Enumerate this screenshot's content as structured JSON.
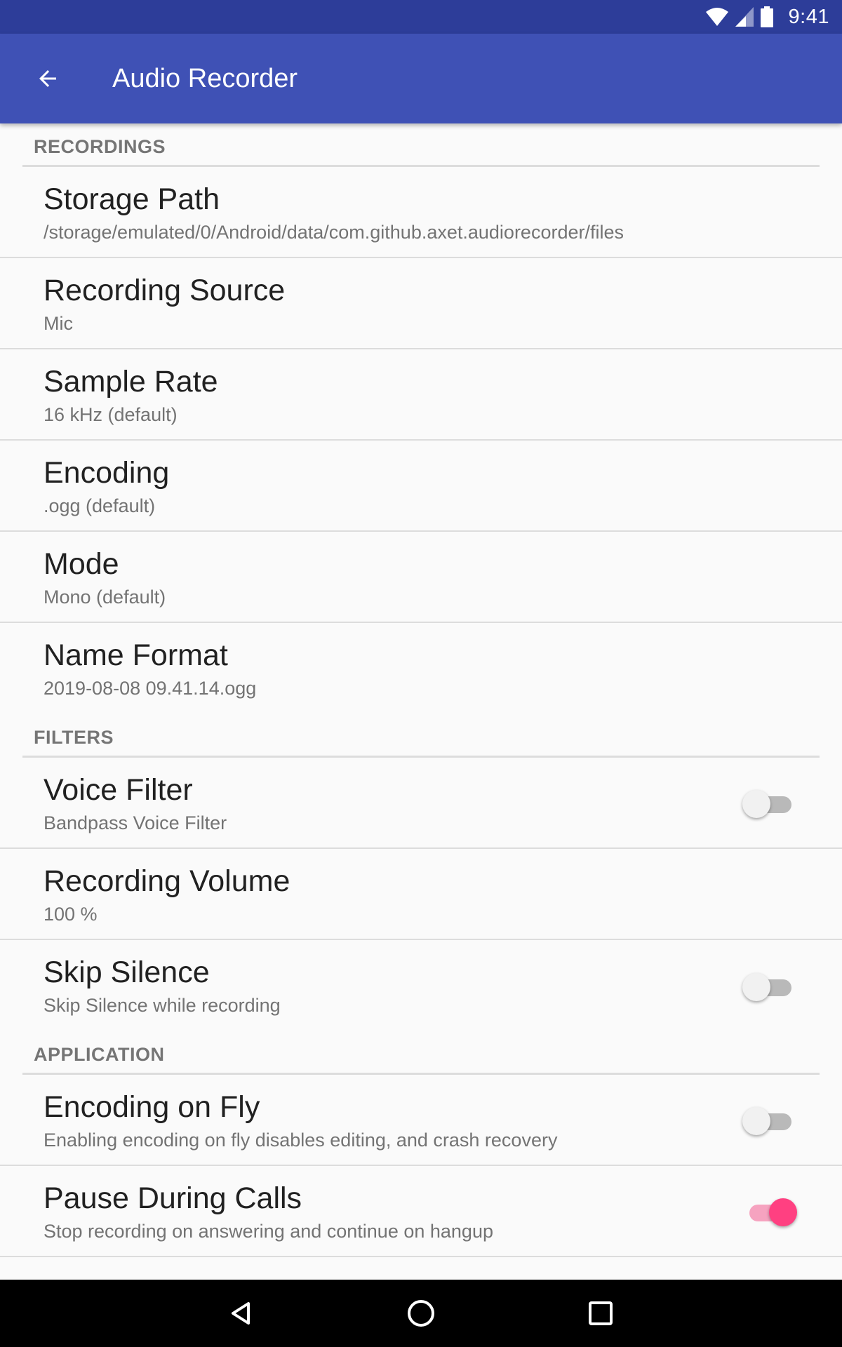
{
  "status_bar": {
    "time": "9:41",
    "icons": [
      "wifi-icon",
      "cell-signal-icon",
      "battery-icon"
    ]
  },
  "app_bar": {
    "title": "Audio Recorder",
    "back_icon": "arrow-back-icon",
    "color": "#3f51b5",
    "status_color": "#2d3d99"
  },
  "sections": {
    "recordings": {
      "header": "RECORDINGS",
      "items": [
        {
          "title": "Storage Path",
          "summary": "/storage/emulated/0/Android/data/com.github.axet.audiorecorder/files"
        },
        {
          "title": "Recording Source",
          "summary": "Mic"
        },
        {
          "title": "Sample Rate",
          "summary": "16 kHz (default)"
        },
        {
          "title": "Encoding",
          "summary": ".ogg (default)"
        },
        {
          "title": "Mode",
          "summary": "Mono (default)"
        },
        {
          "title": "Name Format",
          "summary": "2019-08-08 09.41.14.ogg"
        }
      ]
    },
    "filters": {
      "header": "FILTERS",
      "items": [
        {
          "title": "Voice Filter",
          "summary": "Bandpass Voice Filter",
          "switch": false
        },
        {
          "title": "Recording Volume",
          "summary": "100 %"
        },
        {
          "title": "Skip Silence",
          "summary": "Skip Silence while recording",
          "switch": false
        }
      ]
    },
    "application": {
      "header": "APPLICATION",
      "items": [
        {
          "title": "Encoding on Fly",
          "summary": "Enabling encoding on fly disables editing, and crash recovery",
          "switch": false
        },
        {
          "title": "Pause During Calls",
          "summary": "Stop recording on answering and continue on hangup",
          "switch": true
        }
      ]
    }
  },
  "accent_color": "#ff4081",
  "nav_bar": {
    "icons": [
      "back-triangle-icon",
      "home-circle-icon",
      "recents-square-icon"
    ]
  }
}
